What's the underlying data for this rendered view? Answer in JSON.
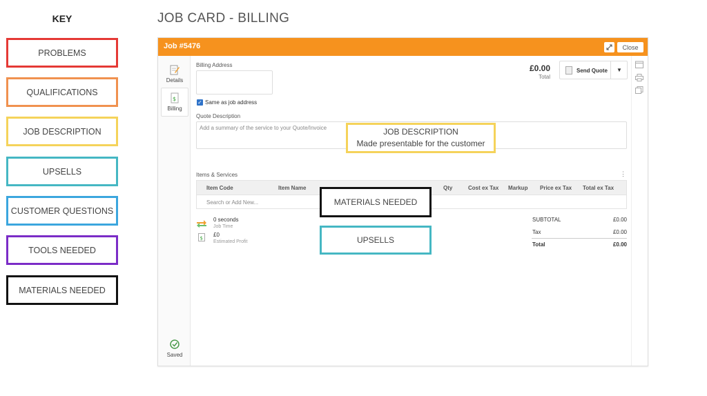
{
  "key": {
    "title": "KEY",
    "items": [
      {
        "label": "PROBLEMS",
        "color": "#e53935"
      },
      {
        "label": "QUALIFICATIONS",
        "color": "#f0914f"
      },
      {
        "label": "JOB DESCRIPTION",
        "color": "#f5d35a"
      },
      {
        "label": "UPSELLS",
        "color": "#45b7c3"
      },
      {
        "label": "CUSTOMER QUESTIONS",
        "color": "#3ba6de"
      },
      {
        "label": "TOOLS NEEDED",
        "color": "#7b2cc7"
      },
      {
        "label": "MATERIALS NEEDED",
        "color": "#111111"
      }
    ]
  },
  "page_title": "JOB CARD - BILLING",
  "job": {
    "title": "Job #5476",
    "close_label": "Close",
    "accent_color": "#f6921e",
    "nav": [
      {
        "label": "Details",
        "icon": "details-icon"
      },
      {
        "label": "Billing",
        "icon": "billing-icon"
      }
    ],
    "saved_label": "Saved",
    "billing_address_label": "Billing Address",
    "same_as_job_label": "Same as job address",
    "same_as_job_checked": true,
    "quote_description_label": "Quote Description",
    "quote_description_placeholder": "Add a summary of the service to your Quote/Invoice",
    "total_amount": "£0.00",
    "total_label": "Total",
    "send_quote_label": "Send Quote",
    "items_services_label": "Items & Services",
    "columns": [
      "Item Code",
      "Item Name",
      "Qty",
      "Cost ex Tax",
      "Markup",
      "Price ex Tax",
      "Total ex Tax"
    ],
    "search_placeholder": "Search or Add New...",
    "job_time_value": "0 seconds",
    "job_time_label": "Job Time",
    "profit_value": "£0",
    "profit_label": "Estimated Profit",
    "summary": [
      {
        "label": "SUBTOTAL",
        "value": "£0.00"
      },
      {
        "label": "Tax",
        "value": "£0.00"
      },
      {
        "label": "Total",
        "value": "£0.00"
      }
    ]
  },
  "overlays": {
    "job_description": {
      "line1": "JOB DESCRIPTION",
      "line2": "Made presentable for the customer",
      "color": "#f5d35a"
    },
    "materials_needed": {
      "label": "MATERIALS NEEDED",
      "color": "#111111"
    },
    "upsells": {
      "label": "UPSELLS",
      "color": "#45b7c3"
    }
  }
}
